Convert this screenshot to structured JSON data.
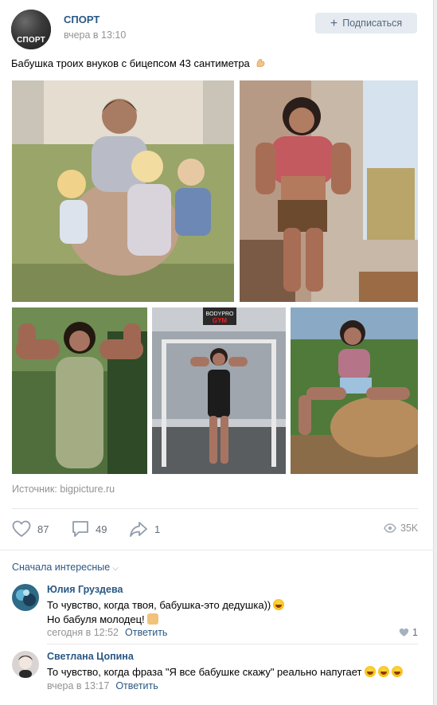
{
  "post": {
    "group_name": "СПОРТ",
    "avatar_text": "СПОРТ",
    "time": "вчера в 13:10",
    "subscribe_label": "Подписаться",
    "text": "Бабушка троих внуков с бицепсом 43 сантиметра",
    "source_label": "Источник:",
    "source_link": "bigpicture.ru",
    "gym_sign_top": "BODYPRO",
    "gym_sign_bottom": "GYM",
    "likes": "87",
    "comments": "49",
    "shares": "1",
    "views": "35K"
  },
  "comments_section": {
    "sort_label": "Сначала интересные",
    "items": [
      {
        "author": "Юлия Груздева",
        "line1": "То чувство, когда твоя, бабушка-это дедушка))",
        "line2": "Но бабуля молодец!",
        "time": "сегодня в 12:52",
        "reply": "Ответить",
        "likes": "1"
      },
      {
        "author": "Светлана Цопина",
        "line1": "То чувство, когда фраза \"Я все бабушке скажу\" реально напугает",
        "time": "вчера в 13:17",
        "reply": "Ответить"
      }
    ]
  },
  "colors": {
    "link": "#2a5885",
    "muted": "#939393",
    "button_bg": "#e5ebf1"
  }
}
